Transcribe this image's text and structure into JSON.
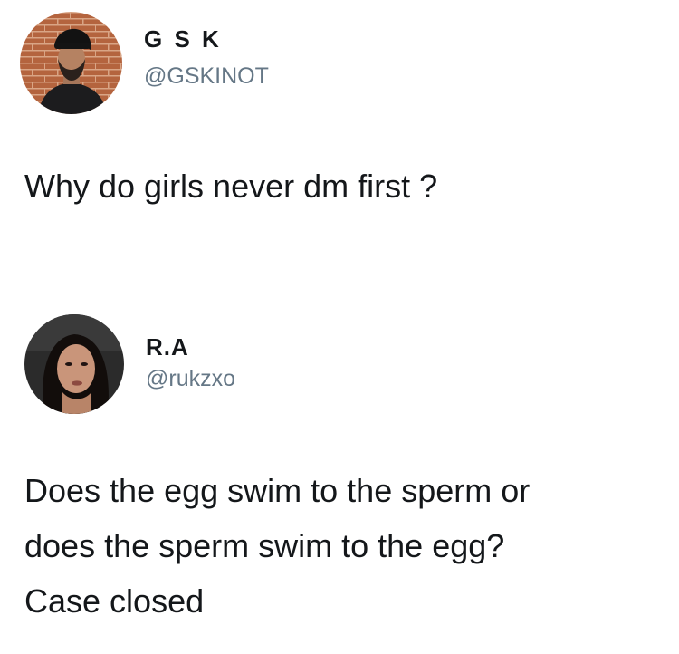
{
  "tweets": [
    {
      "display_name": "G S K",
      "handle": "@GSKINOT",
      "text": "Why do girls never dm first ?"
    },
    {
      "display_name": "R.A",
      "handle": "@rukzxo",
      "text": "Does the egg swim to the sperm or\ndoes the sperm swim to the egg?\nCase closed"
    }
  ]
}
